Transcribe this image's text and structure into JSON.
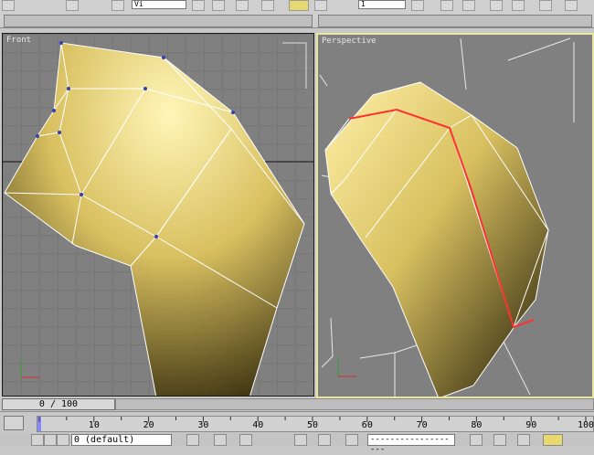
{
  "viewports": {
    "front": {
      "label": "Front"
    },
    "perspective": {
      "label": "Perspective"
    }
  },
  "toolbar": {
    "view_combo": "Vi",
    "zoom_combo": "1"
  },
  "timeline": {
    "frame_counter": "0 / 100",
    "ruler_ticks": [
      "10",
      "20",
      "30",
      "40",
      "50",
      "60",
      "70",
      "80",
      "90",
      "100"
    ]
  },
  "status": {
    "layer_combo": "0 (default)",
    "selection_combo": "-------------------"
  },
  "colors": {
    "viewport_bg": "#808080",
    "active_border": "#e6e6a0",
    "mesh_edge": "#ffffff",
    "selected_edge": "#ff3030",
    "vertex": "#3040c0"
  }
}
